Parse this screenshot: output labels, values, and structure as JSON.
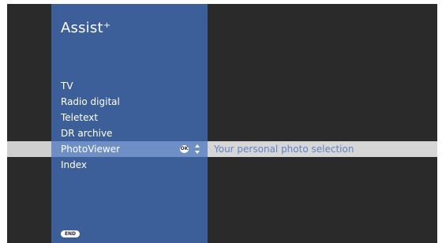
{
  "app": {
    "title": "Assist⁺"
  },
  "menu": {
    "items": [
      {
        "label": "TV"
      },
      {
        "label": "Radio digital"
      },
      {
        "label": "Teletext"
      },
      {
        "label": "DR archive"
      },
      {
        "label": "PhotoViewer",
        "selected": true,
        "description": "Your personal photo selection"
      },
      {
        "label": "Index"
      }
    ],
    "ok_icon_text": "OK",
    "updown_icon": "up-down-arrows-icon"
  },
  "footer": {
    "end_label": "END"
  },
  "colors": {
    "screen_bg": "#2a2a2a",
    "panel_blue": "#3d5f99",
    "selected_blue": "#6e8ec6",
    "highlight_gray": "#d6d6d6",
    "description_blue": "#5f84c4"
  }
}
